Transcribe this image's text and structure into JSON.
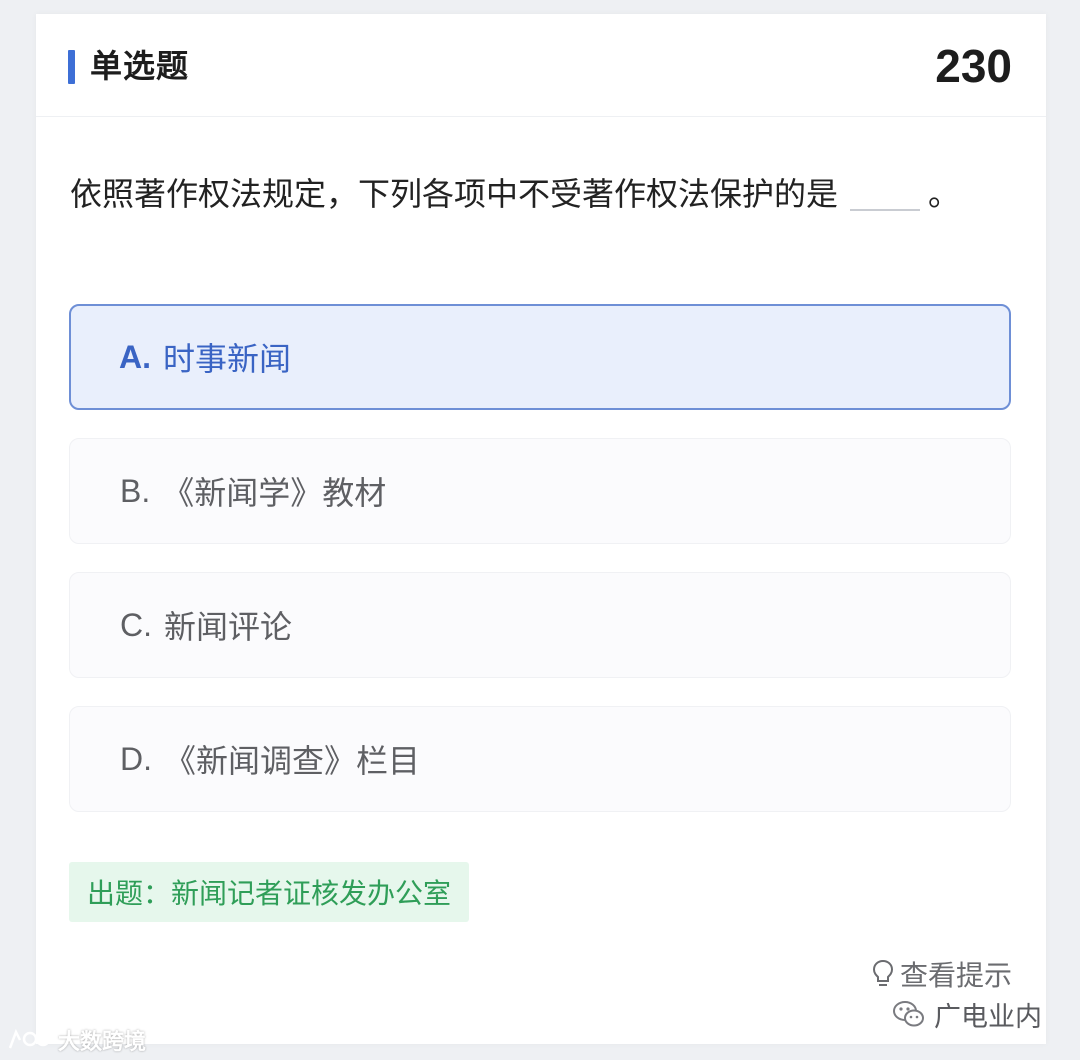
{
  "header": {
    "title": "单选题",
    "question_number": "230",
    "accent_color": "#3d6fd6"
  },
  "question": {
    "text": "依照著作权法规定，下列各项中不受著作权法保护的是",
    "end_mark": "。"
  },
  "options": [
    {
      "letter": "A.",
      "label": "时事新闻",
      "selected": true
    },
    {
      "letter": "B.",
      "label": "《新闻学》教材",
      "selected": false
    },
    {
      "letter": "C.",
      "label": "新闻评论",
      "selected": false
    },
    {
      "letter": "D.",
      "label": "《新闻调查》栏目",
      "selected": false
    }
  ],
  "source": {
    "text": "出题：新闻记者证核发办公室",
    "color": "#2f9e58"
  },
  "hint": {
    "label": "查看提示",
    "icon": "lightbulb-icon"
  },
  "watermarks": {
    "right": "广电业内",
    "right_icon": "wechat-icon",
    "left": "大数跨境",
    "left_icon": "logo-icon"
  }
}
